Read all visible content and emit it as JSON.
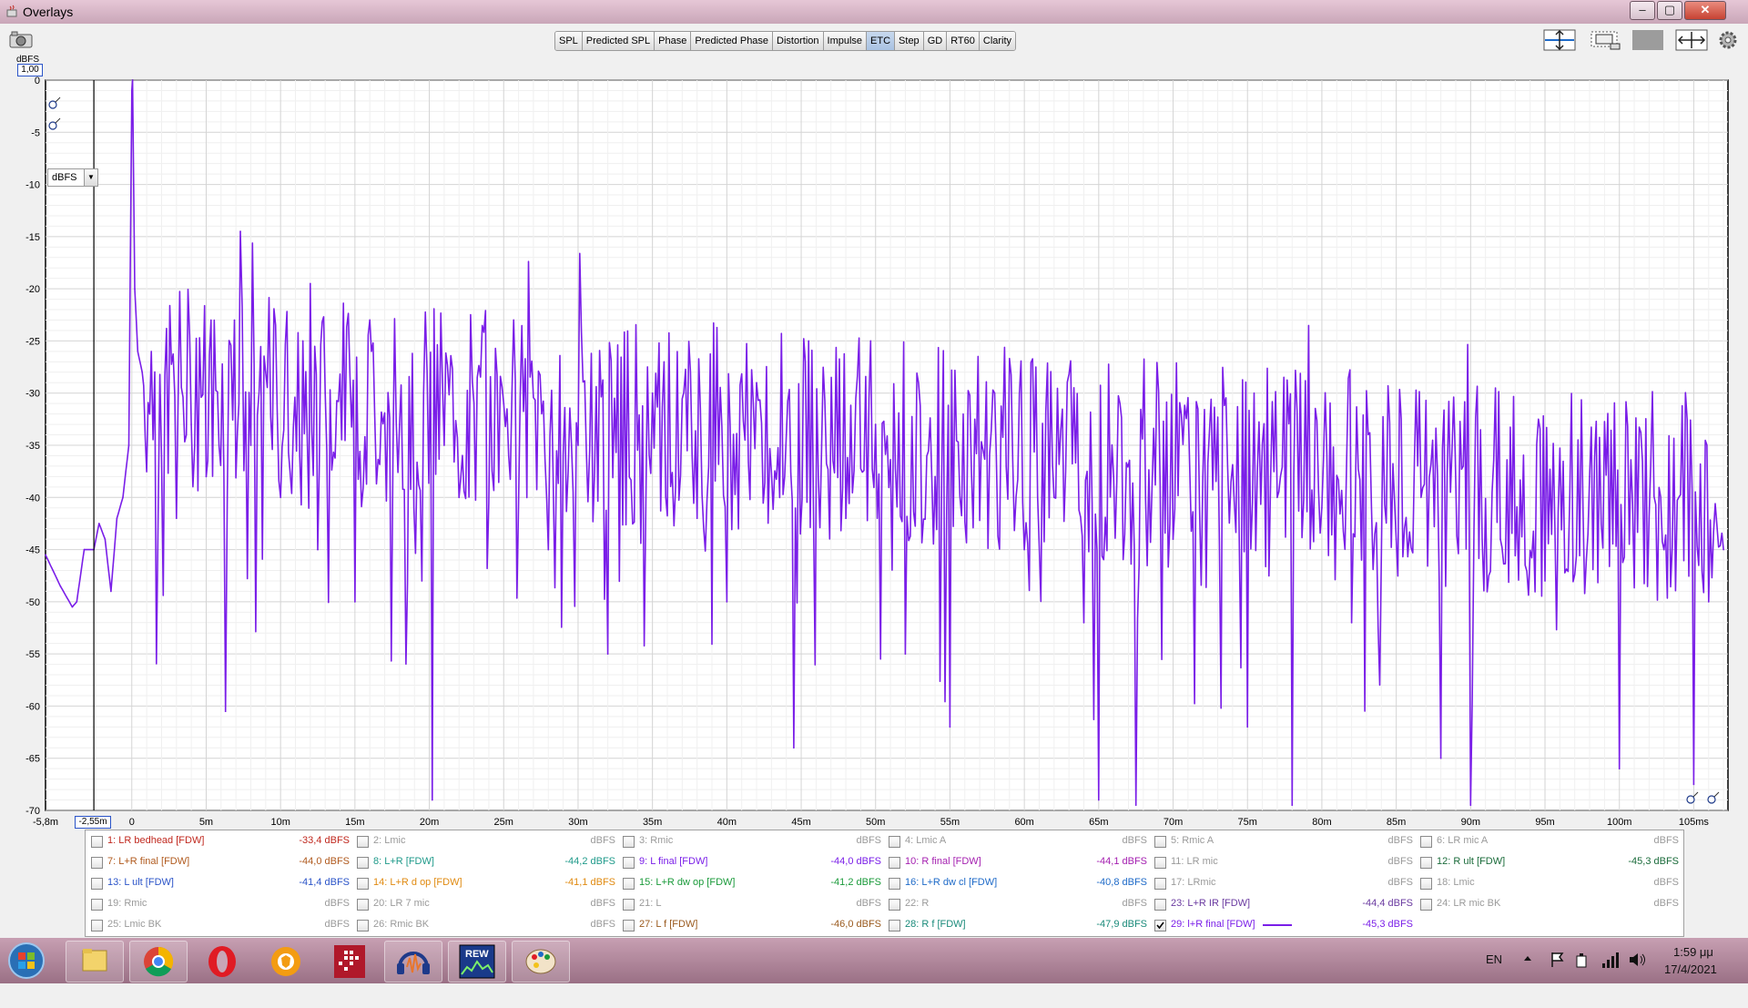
{
  "window": {
    "title": "Overlays",
    "minimize": "–",
    "maximize": "▢",
    "close": "✕"
  },
  "tabs": [
    {
      "label": "SPL",
      "active": false
    },
    {
      "label": "Predicted SPL",
      "active": false
    },
    {
      "label": "Phase",
      "active": false
    },
    {
      "label": "Predicted Phase",
      "active": false
    },
    {
      "label": "Distortion",
      "active": false
    },
    {
      "label": "Impulse",
      "active": false
    },
    {
      "label": "ETC",
      "active": true
    },
    {
      "label": "Step",
      "active": false
    },
    {
      "label": "GD",
      "active": false
    },
    {
      "label": "RT60",
      "active": false
    },
    {
      "label": "Clarity",
      "active": false
    }
  ],
  "toolbar_icons": [
    "capture-icon",
    "vertical-scale-icon",
    "fit-window-icon",
    "blank-tool-icon",
    "horizontal-scale-icon",
    "settings-icon"
  ],
  "plot": {
    "unit_label": "dBFS",
    "scale_box": "1,00",
    "unit_select": "dBFS",
    "cursor_label": "-2,55m",
    "y_ticks": [
      "0",
      "-5",
      "-10",
      "-15",
      "-20",
      "-25",
      "-30",
      "-35",
      "-40",
      "-45",
      "-50",
      "-55",
      "-60",
      "-65",
      "-70"
    ],
    "x_ticks": [
      "-5,8m",
      "0",
      "5m",
      "10m",
      "15m",
      "20m",
      "25m",
      "30m",
      "35m",
      "40m",
      "45m",
      "50m",
      "55m",
      "60m",
      "65m",
      "70m",
      "75m",
      "80m",
      "85m",
      "90m",
      "95m",
      "100m",
      "105ms"
    ]
  },
  "chart_data": {
    "type": "line",
    "title": "",
    "xlabel": "",
    "ylabel": "dBFS",
    "xlim": [
      -5.8,
      107.3
    ],
    "ylim": [
      -70,
      0
    ],
    "grid": true,
    "series": [
      {
        "name": "29: l+R final [FDW]",
        "color": "#7a1ee8",
        "x": [
          -5.8,
          -4.8,
          -4.0,
          -3.7,
          -3.2,
          -2.55,
          -2.2,
          -1.8,
          -1.4,
          -1.0,
          -0.6,
          -0.2,
          0.0,
          0.05,
          0.2,
          0.4,
          0.7,
          1.2,
          2.0,
          3.0,
          4.0,
          5.0,
          6.3,
          6.9,
          7.3,
          8.0,
          9.0,
          10.0,
          11.5,
          12.0,
          12.5,
          13.0,
          15.0,
          18.0,
          19.5,
          20.2,
          21.0,
          22.0,
          25.0,
          28.0,
          30.0,
          32.0,
          35.0,
          38.0,
          40.0,
          42.0,
          44.0,
          44.5,
          45.5,
          48.0,
          50.0,
          52.0,
          54.0,
          55.0,
          58.0,
          60.0,
          62.0,
          64.0,
          65.0,
          66.0,
          67.5,
          70.0,
          72.0,
          75.0,
          77.0,
          78.0,
          80.0,
          82.0,
          85.0,
          88.0,
          89.5,
          90.0,
          92.0,
          95.0,
          98.0,
          100.0,
          103.0,
          105.0,
          106.0,
          107.0
        ],
        "y": [
          -45.5,
          -48.5,
          -50.5,
          -50.0,
          -45.0,
          -45.0,
          -42.5,
          -44.0,
          -49.0,
          -42.0,
          -40.0,
          -35.0,
          -1.0,
          0.0,
          -20.0,
          -26.0,
          -28.0,
          -32.0,
          -36.0,
          -42.0,
          -33.0,
          -38.0,
          -60.5,
          -23.0,
          -14.5,
          -35.0,
          -28.0,
          -40.0,
          -25.0,
          -19.5,
          -45.0,
          -30.0,
          -50.0,
          -33.0,
          -48.0,
          -69.0,
          -35.0,
          -40.0,
          -31.0,
          -45.0,
          -35.0,
          -55.0,
          -30.0,
          -42.0,
          -50.0,
          -29.0,
          -34.0,
          -64.0,
          -25.0,
          -42.0,
          -33.0,
          -55.0,
          -38.0,
          -62.0,
          -30.0,
          -45.0,
          -40.0,
          -52.0,
          -69.0,
          -38.0,
          -69.5,
          -44.0,
          -38.0,
          -62.0,
          -40.0,
          -69.5,
          -41.0,
          -52.0,
          -44.0,
          -65.0,
          -37.0,
          -69.5,
          -44.0,
          -48.0,
          -38.0,
          -66.0,
          -45.0,
          -67.5,
          -50.0,
          -45.0
        ]
      }
    ]
  },
  "legend": {
    "rows": [
      [
        {
          "name": "1: LR bedhead [FDW]",
          "value": "-33,4 dBFS",
          "color": "#c0281e",
          "enabled": true,
          "checked": false
        },
        {
          "name": "2: Lmic",
          "value": "dBFS",
          "color": "#9a9a9a",
          "enabled": false,
          "checked": false
        },
        {
          "name": "3: Rmic",
          "value": "dBFS",
          "color": "#9a9a9a",
          "enabled": false,
          "checked": false
        },
        {
          "name": "4: Lmic A",
          "value": "dBFS",
          "color": "#9a9a9a",
          "enabled": false,
          "checked": false
        },
        {
          "name": "5: Rmic A",
          "value": "dBFS",
          "color": "#9a9a9a",
          "enabled": false,
          "checked": false
        },
        {
          "name": "6: LR mic A",
          "value": "dBFS",
          "color": "#9a9a9a",
          "enabled": false,
          "checked": false
        }
      ],
      [
        {
          "name": "7: L+R  final [FDW]",
          "value": "-44,0 dBFS",
          "color": "#b05a1e",
          "enabled": true,
          "checked": false
        },
        {
          "name": "8: L+R [FDW]",
          "value": "-44,2 dBFS",
          "color": "#1f9a8a",
          "enabled": true,
          "checked": false
        },
        {
          "name": "9: L final [FDW]",
          "value": "-44,0 dBFS",
          "color": "#7a1ee8",
          "enabled": true,
          "checked": false
        },
        {
          "name": "10: R final [FDW]",
          "value": "-44,1 dBFS",
          "color": "#a41fb0",
          "enabled": true,
          "checked": false
        },
        {
          "name": "11: LR mic",
          "value": "dBFS",
          "color": "#9a9a9a",
          "enabled": false,
          "checked": false
        },
        {
          "name": "12: R ult [FDW]",
          "value": "-45,3 dBFS",
          "color": "#1a6b3a",
          "enabled": true,
          "checked": false
        }
      ],
      [
        {
          "name": "13: L ult [FDW]",
          "value": "-41,4 dBFS",
          "color": "#2b54c8",
          "enabled": true,
          "checked": false
        },
        {
          "name": "14: L+R d op [FDW]",
          "value": "-41,1 dBFS",
          "color": "#e08a10",
          "enabled": true,
          "checked": false
        },
        {
          "name": "15: L+R dw op [FDW]",
          "value": "-41,2 dBFS",
          "color": "#1a9a3a",
          "enabled": true,
          "checked": false
        },
        {
          "name": "16: L+R dw cl [FDW]",
          "value": "-40,8 dBFS",
          "color": "#1e6ac8",
          "enabled": true,
          "checked": false
        },
        {
          "name": "17: LRmic",
          "value": "dBFS",
          "color": "#9a9a9a",
          "enabled": false,
          "checked": false
        },
        {
          "name": "18: Lmic",
          "value": "dBFS",
          "color": "#9a9a9a",
          "enabled": false,
          "checked": false
        }
      ],
      [
        {
          "name": "19: Rmic",
          "value": "dBFS",
          "color": "#9a9a9a",
          "enabled": false,
          "checked": false
        },
        {
          "name": "20: LR 7 mic",
          "value": "dBFS",
          "color": "#9a9a9a",
          "enabled": false,
          "checked": false
        },
        {
          "name": "21: L",
          "value": "dBFS",
          "color": "#9a9a9a",
          "enabled": false,
          "checked": false
        },
        {
          "name": "22: R",
          "value": "dBFS",
          "color": "#9a9a9a",
          "enabled": false,
          "checked": false
        },
        {
          "name": "23: L+R IR [FDW]",
          "value": "-44,4 dBFS",
          "color": "#6a3aa0",
          "enabled": true,
          "checked": false
        },
        {
          "name": "24: LR mic BK",
          "value": "dBFS",
          "color": "#9a9a9a",
          "enabled": false,
          "checked": false
        }
      ],
      [
        {
          "name": "25: Lmic BK",
          "value": "dBFS",
          "color": "#9a9a9a",
          "enabled": false,
          "checked": false
        },
        {
          "name": "26: Rmic BK",
          "value": "dBFS",
          "color": "#9a9a9a",
          "enabled": false,
          "checked": false
        },
        {
          "name": "27: L f [FDW]",
          "value": "-46,0 dBFS",
          "color": "#9a5a1e",
          "enabled": true,
          "checked": false
        },
        {
          "name": "28: R f [FDW]",
          "value": "-47,9 dBFS",
          "color": "#1a8a7a",
          "enabled": true,
          "checked": false
        },
        {
          "name": "29: l+R final [FDW]",
          "value": "-45,3 dBFS",
          "color": "#7a1ee8",
          "enabled": true,
          "checked": true
        },
        {
          "name": "",
          "value": "",
          "color": "#9a9a9a",
          "enabled": false,
          "checked": false
        }
      ]
    ]
  },
  "taskbar": {
    "apps": [
      "start-orb-icon",
      "file-explorer-icon",
      "chrome-icon",
      "opera-icon",
      "browser-shield-icon",
      "app-red-grid-icon",
      "audacity-icon",
      "rew-icon",
      "paint-icon"
    ],
    "lang": "EN",
    "time": "1:59 μμ",
    "date": "17/4/2021"
  }
}
